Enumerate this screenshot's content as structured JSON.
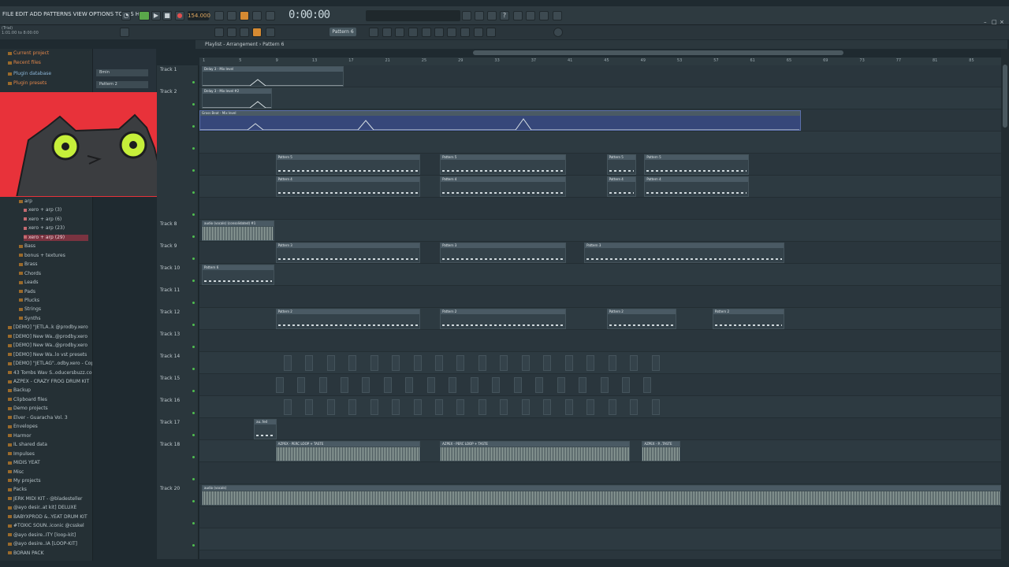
{
  "menu": [
    "FILE",
    "EDIT",
    "ADD",
    "PATTERNS",
    "VIEW",
    "OPTIONS",
    "TOOLS",
    "HELP"
  ],
  "transport": {
    "tempo": "154.000",
    "time": "0:00:00",
    "pattern": "Pattern 6"
  },
  "hint": [
    "(Trial)",
    "1:01:00 to 8:00:00",
    "Pattern 6"
  ],
  "playlist": {
    "breadcrumb": "Playlist - Arrangement › Pattern 6"
  },
  "browser": {
    "items": [
      {
        "label": "Current project",
        "style": "orange"
      },
      {
        "label": "Recent files",
        "style": "orange"
      },
      {
        "label": "Plugin database",
        "style": "blue"
      },
      {
        "label": "Plugin presets",
        "style": "orange"
      },
      {
        "label": "arp",
        "style": "folder"
      },
      {
        "label": "xero + arp (3)",
        "style": "pat"
      },
      {
        "label": "xero + arp (6)",
        "style": "pat"
      },
      {
        "label": "xero + arp (23)",
        "style": "pat"
      },
      {
        "label": "xero + arp (29)",
        "style": "sel"
      },
      {
        "label": "Bass",
        "style": "folder"
      },
      {
        "label": "bonus + textures",
        "style": "folder"
      },
      {
        "label": "Brass",
        "style": "folder"
      },
      {
        "label": "Chords",
        "style": "folder"
      },
      {
        "label": "Leads",
        "style": "folder"
      },
      {
        "label": "Pads",
        "style": "folder"
      },
      {
        "label": "Plucks",
        "style": "folder"
      },
      {
        "label": "Strings",
        "style": "folder"
      },
      {
        "label": "Synths",
        "style": "folder"
      },
      {
        "label": "[DEMO] \"JETLA..k @prodby.xero",
        "style": "folder"
      },
      {
        "label": "[DEMO] New Wa..@prodby.xero",
        "style": "folder"
      },
      {
        "label": "[DEMO] New Wa..@prodby.xero",
        "style": "folder"
      },
      {
        "label": "[DEMO] New Wa..lo vst presets",
        "style": "folder"
      },
      {
        "label": "[DEMO] \"JETLAG\"..odby.xero - Copy",
        "style": "folder"
      },
      {
        "label": "43 Tombs Wav S..oducersbuzz.com",
        "style": "folder"
      },
      {
        "label": "AZPEX - CRAZY FROG DRUM KIT",
        "style": "folder"
      },
      {
        "label": "Backup",
        "style": "folder"
      },
      {
        "label": "Clipboard files",
        "style": "folder"
      },
      {
        "label": "Demo projects",
        "style": "folder"
      },
      {
        "label": "Elver - Guaracha Vol. 3",
        "style": "folder"
      },
      {
        "label": "Envelopes",
        "style": "folder"
      },
      {
        "label": "Harmor",
        "style": "folder"
      },
      {
        "label": "IL shared data",
        "style": "folder"
      },
      {
        "label": "Impulses",
        "style": "folder"
      },
      {
        "label": "MIDIS YEAT",
        "style": "folder"
      },
      {
        "label": "Misc",
        "style": "folder"
      },
      {
        "label": "My projects",
        "style": "folder"
      },
      {
        "label": "Packs",
        "style": "folder"
      },
      {
        "label": "JERK MIDI KIT - @bladesteller",
        "style": "folder"
      },
      {
        "label": "@ayo desir..at kit] DELUXE",
        "style": "folder"
      },
      {
        "label": "BABYXPROD &..YEAT DRUM KIT",
        "style": "folder"
      },
      {
        "label": "#TOXIC SOUN..iconic @csskel",
        "style": "folder"
      },
      {
        "label": "@ayo desire..ITY [loop-kit]",
        "style": "folder"
      },
      {
        "label": "@ayo desire..IA [LOOP-KIT]",
        "style": "folder"
      },
      {
        "label": "BORAN PACK",
        "style": "folder"
      }
    ]
  },
  "channels": [
    "Bmin",
    "Pattern 2"
  ],
  "tracks": [
    "Track 1",
    "Track 2",
    "",
    "",
    "",
    "",
    "",
    "Track 8",
    "Track 9",
    "Track 10",
    "Track 11",
    "Track 12",
    "Track 13",
    "Track 14",
    "Track 15",
    "Track 16",
    "Track 17",
    "Track 18",
    "",
    "Track 20",
    "",
    ""
  ],
  "ruler": [
    "1",
    "5",
    "9",
    "13",
    "17",
    "21",
    "25",
    "29",
    "33",
    "37",
    "41",
    "45",
    "49",
    "53",
    "57",
    "61",
    "65",
    "69",
    "73",
    "77",
    "81",
    "85"
  ],
  "clips": [
    {
      "lane": 0,
      "start": 0.003,
      "end": 0.18,
      "label": "Delay 3 - Mix level",
      "kind": "auto"
    },
    {
      "lane": 1,
      "start": 0.003,
      "end": 0.09,
      "label": "Delay 3 - Mix level #2",
      "kind": "auto"
    },
    {
      "lane": 2,
      "start": 0.0,
      "end": 0.75,
      "label": "Gross Beat - Mix level",
      "kind": "blue"
    },
    {
      "lane": 4,
      "start": 0.095,
      "end": 0.275,
      "label": "Pattern 5",
      "kind": "pat"
    },
    {
      "lane": 4,
      "start": 0.3,
      "end": 0.457,
      "label": "Pattern 5",
      "kind": "pat"
    },
    {
      "lane": 4,
      "start": 0.508,
      "end": 0.545,
      "label": "Pattern 5",
      "kind": "pat"
    },
    {
      "lane": 4,
      "start": 0.555,
      "end": 0.685,
      "label": "Pattern 5",
      "kind": "pat"
    },
    {
      "lane": 5,
      "start": 0.095,
      "end": 0.275,
      "label": "Pattern 4",
      "kind": "pat"
    },
    {
      "lane": 5,
      "start": 0.3,
      "end": 0.457,
      "label": "Pattern 4",
      "kind": "pat"
    },
    {
      "lane": 5,
      "start": 0.508,
      "end": 0.545,
      "label": "Pattern 4",
      "kind": "pat"
    },
    {
      "lane": 5,
      "start": 0.555,
      "end": 0.685,
      "label": "Pattern 4",
      "kind": "pat"
    },
    {
      "lane": 7,
      "start": 0.003,
      "end": 0.093,
      "label": "audio (vocals) (consolidated) #1",
      "kind": "audio"
    },
    {
      "lane": 8,
      "start": 0.095,
      "end": 0.275,
      "label": "Pattern 3",
      "kind": "pat"
    },
    {
      "lane": 8,
      "start": 0.3,
      "end": 0.457,
      "label": "Pattern 3",
      "kind": "pat"
    },
    {
      "lane": 8,
      "start": 0.48,
      "end": 0.73,
      "label": "Pattern 3",
      "kind": "pat"
    },
    {
      "lane": 9,
      "start": 0.003,
      "end": 0.093,
      "label": "Pattern 6",
      "kind": "pat"
    },
    {
      "lane": 11,
      "start": 0.095,
      "end": 0.275,
      "label": "Pattern 2",
      "kind": "pat"
    },
    {
      "lane": 11,
      "start": 0.3,
      "end": 0.457,
      "label": "Pattern 2",
      "kind": "pat"
    },
    {
      "lane": 11,
      "start": 0.508,
      "end": 0.595,
      "label": "Pattern 2",
      "kind": "pat"
    },
    {
      "lane": 11,
      "start": 0.64,
      "end": 0.73,
      "label": "Pattern 2",
      "kind": "pat"
    },
    {
      "lane": 16,
      "start": 0.068,
      "end": 0.096,
      "label": "au..fed",
      "kind": "pat"
    },
    {
      "lane": 17,
      "start": 0.095,
      "end": 0.275,
      "label": "AZPEX - PERC LOOP + TASTE",
      "kind": "audio"
    },
    {
      "lane": 17,
      "start": 0.3,
      "end": 0.537,
      "label": "AZPEX - PERC LOOP + TASTE",
      "kind": "audio"
    },
    {
      "lane": 17,
      "start": 0.552,
      "end": 0.6,
      "label": "AZPEX - P...TASTE",
      "kind": "audio"
    },
    {
      "lane": 19,
      "start": 0.003,
      "end": 1.0,
      "label": "audio (vocals)",
      "kind": "audio"
    }
  ]
}
